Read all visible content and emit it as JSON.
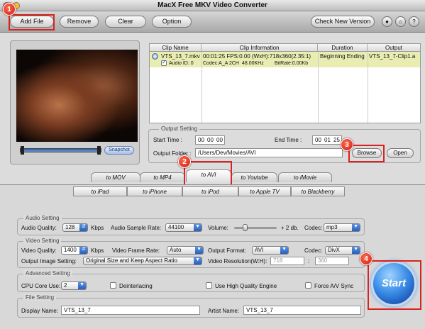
{
  "window": {
    "title": "MacX Free MKV Video Converter"
  },
  "toolbar": {
    "add_file": "Add File",
    "remove": "Remove",
    "clear": "Clear",
    "option": "Option",
    "check_new_version": "Check New Version"
  },
  "badges": [
    "1",
    "2",
    "3",
    "4"
  ],
  "preview": {
    "snapshot": "Snapshot"
  },
  "table": {
    "columns": [
      "Clip Name",
      "Clip Information",
      "Duration",
      "Output"
    ],
    "row": {
      "name": "VTS_13_7.mkv",
      "info": "00:01:25  FPS:0.00   (WxH):718x360(2.35:1)",
      "duration": "Beginning Ending",
      "output": "VTS_13_7-Clip1.a"
    },
    "subrow": {
      "audio": "Audio ID: 0",
      "codec": "Codec:A_A 2CH",
      "rate": "48.00KHz",
      "bitrate": "BitRate:0.00Kb"
    }
  },
  "output_setting": {
    "legend": "Output Setting",
    "start_label": "Start Time :",
    "start_h": "00",
    "start_m": "00",
    "start_s": "00",
    "end_label": "End Time :",
    "end_h": "00",
    "end_m": "01",
    "end_s": "25",
    "folder_label": "Output Folder :",
    "folder_value": "/Users/Dev/Movies/AVI",
    "browse": "Browse",
    "open": "Open"
  },
  "tabs_row1": [
    "to MOV",
    "to MP4",
    "to AVI",
    "to Youtube",
    "to iMovie"
  ],
  "tabs_row2": [
    "to iPad",
    "to iPhone",
    "to iPod",
    "to Apple TV",
    "to Blackberry"
  ],
  "audio": {
    "legend": "Audio Setting",
    "quality_label": "Audio Quality:",
    "quality": "128",
    "quality_unit": "Kbps",
    "rate_label": "Audio Sample Rate:",
    "rate": "44100",
    "volume_label": "Volume:",
    "volume_value": "+ 2 db.",
    "codec_label": "Codec:",
    "codec": "mp3"
  },
  "video": {
    "legend": "Video Setting",
    "quality_label": "Video Quality:",
    "quality": "1400",
    "quality_unit": "Kbps",
    "fps_label": "Video Frame Rate:",
    "fps": "Auto",
    "format_label": "Output Format:",
    "format": "AVI",
    "codec_label": "Codec:",
    "codec": "DivX",
    "image_label": "Output Image Setting:",
    "image": "Original Size and Keep Aspect Ratio",
    "res_label": "Video Resolution(W:H):",
    "res_w": "718",
    "res_h": "360"
  },
  "advanced": {
    "legend": "Advanced Setting",
    "cpu_label": "CPU Core Use:",
    "cpu": "2",
    "deinterlacing": "Deinterlacing",
    "hq_engine": "Use High Quality Engine",
    "force_av": "Force A/V Sync"
  },
  "file": {
    "legend": "File Setting",
    "display_label": "Display Name:",
    "display_value": "VTS_13_7",
    "artist_label": "Artist Name:",
    "artist_value": "VTS_13_7"
  },
  "start": "Start"
}
